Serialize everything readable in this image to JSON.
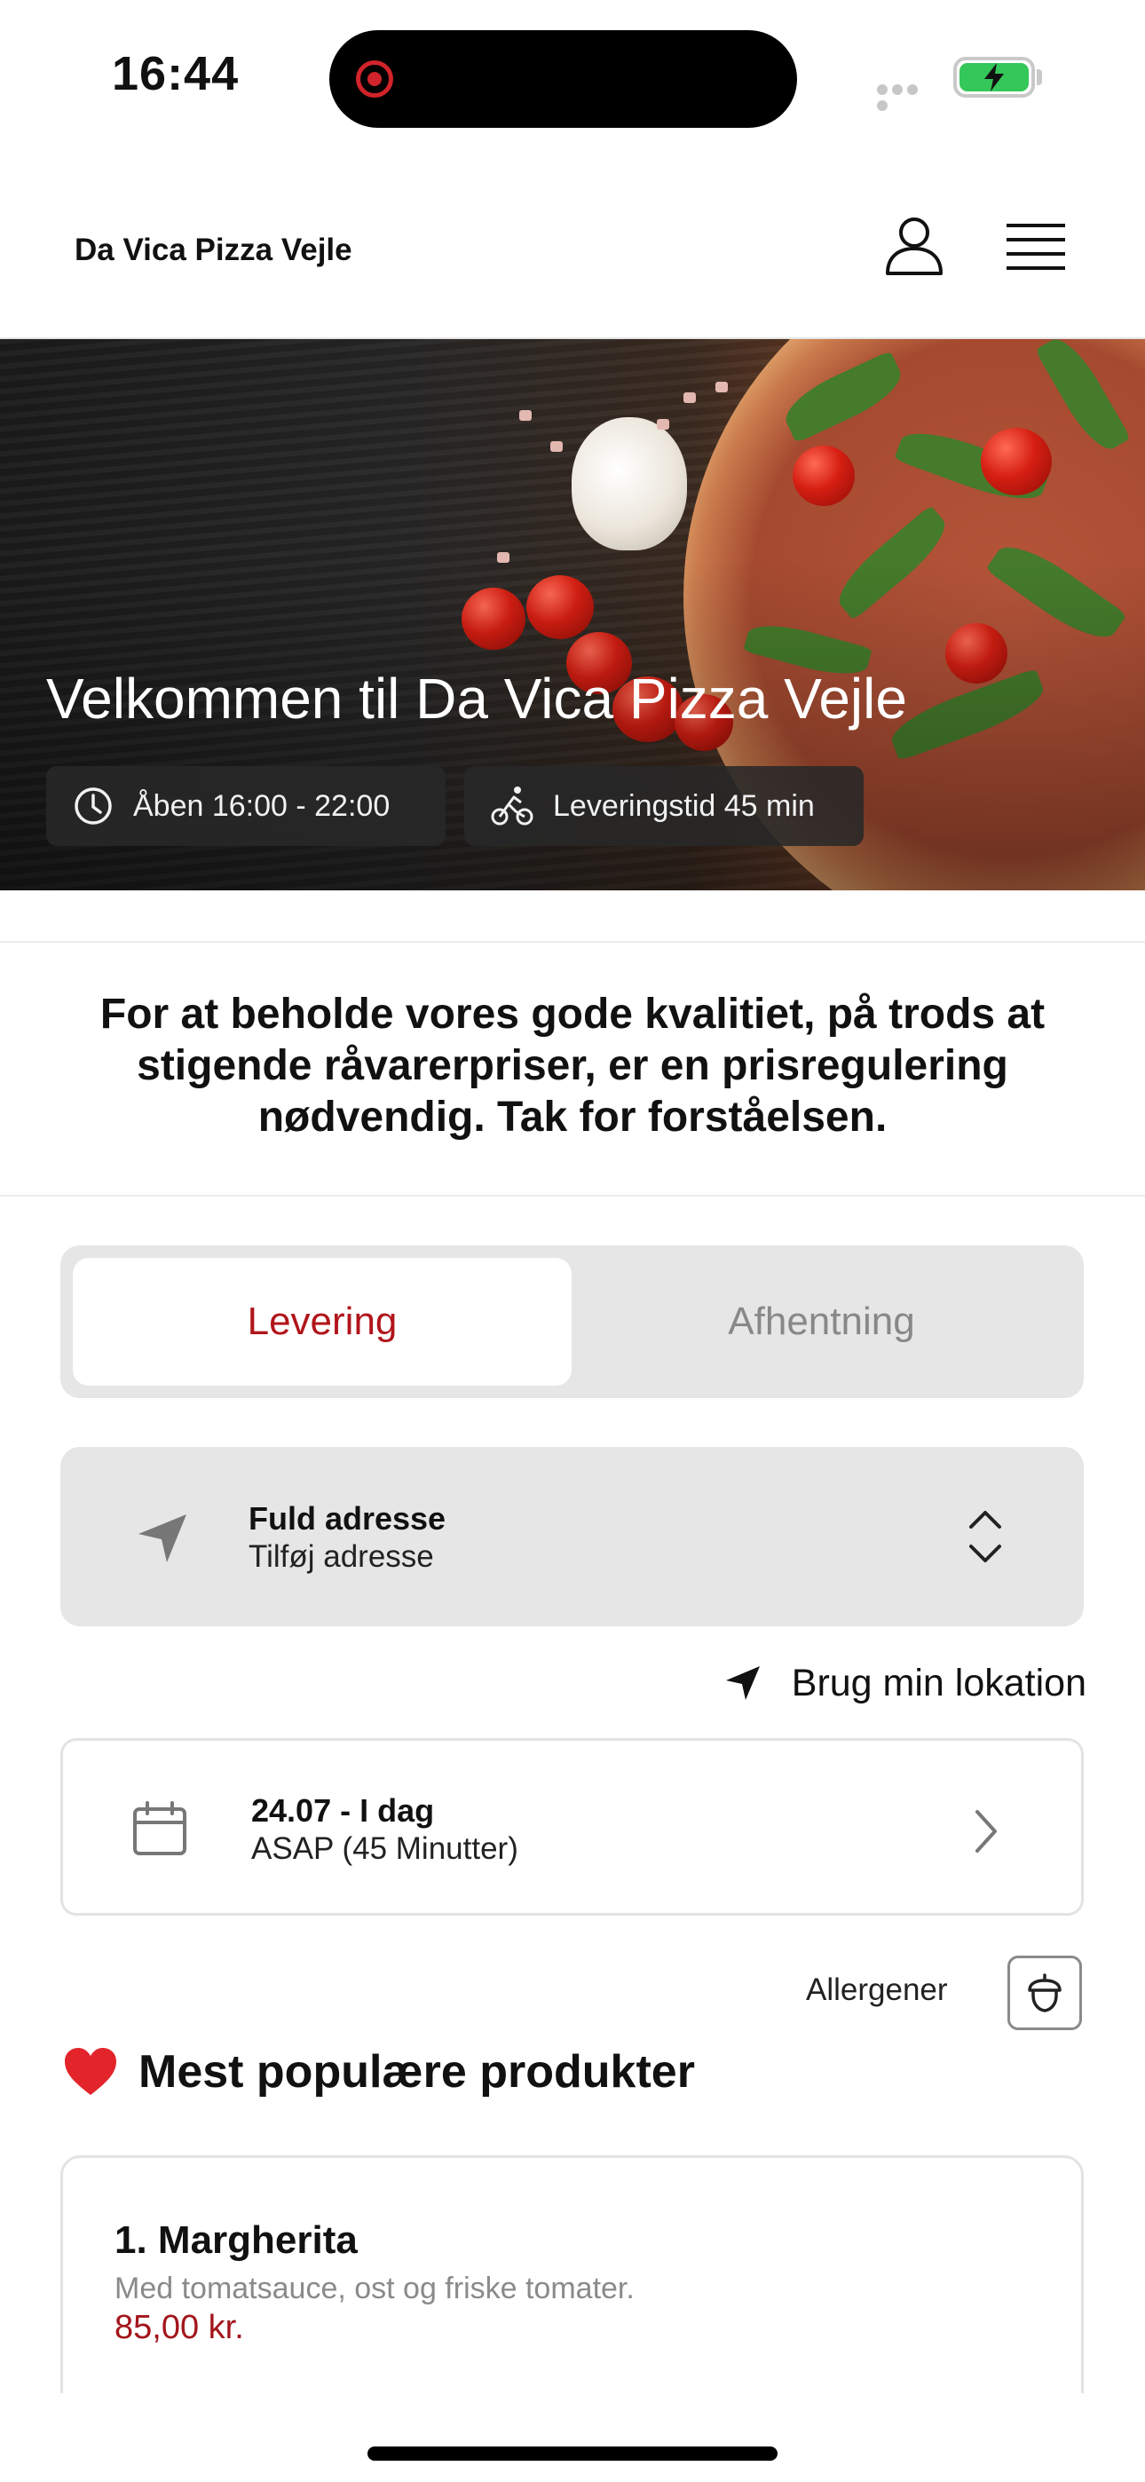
{
  "status_bar": {
    "time": "16:44"
  },
  "header": {
    "brand": "Da Vica Pizza Vejle"
  },
  "hero": {
    "title": "Velkommen til Da Vica Pizza Vejle",
    "open_hours": "Åben 16:00 - 22:00",
    "delivery_time": "Leveringstid 45 min"
  },
  "notice": "For at beholde vores gode kvalitiet, på trods at stigende råvarerpriser, er en  prisregulering nødvendig. Tak for forståelsen.",
  "order_type": {
    "delivery": "Levering",
    "pickup": "Afhentning",
    "selected": "Levering"
  },
  "address": {
    "title": "Fuld adresse",
    "placeholder": "Tilføj adresse"
  },
  "use_location": "Brug min lokation",
  "schedule": {
    "date": "24.07 - I dag",
    "time": "ASAP (45 Minutter)"
  },
  "allergens": {
    "label": "Allergener"
  },
  "popular": {
    "title": "Mest populære produkter",
    "items": [
      {
        "name": "1. Margherita",
        "description": "Med tomatsauce, ost og friske tomater.",
        "price": "85,00 kr."
      }
    ]
  },
  "colors": {
    "accent": "#b0151b",
    "price": "#a3151b",
    "battery": "#34c759",
    "record": "#d1232a"
  }
}
